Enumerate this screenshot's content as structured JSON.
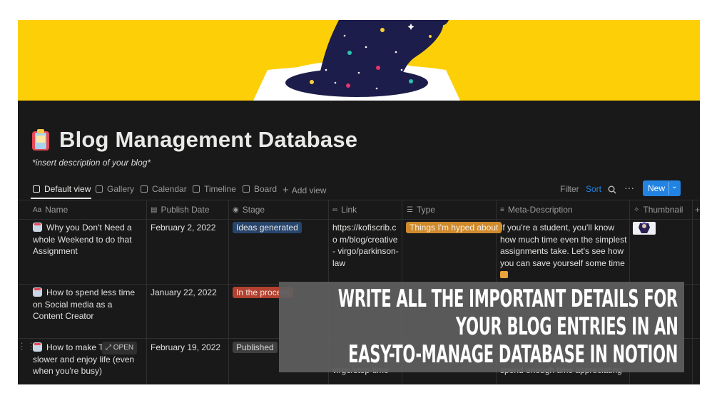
{
  "page": {
    "title": "Blog Management Database",
    "description": "*insert description of your blog*"
  },
  "views": [
    {
      "label": "Default view",
      "icon": "table-icon",
      "active": true
    },
    {
      "label": "Gallery",
      "icon": "gallery-icon"
    },
    {
      "label": "Calendar",
      "icon": "calendar-icon"
    },
    {
      "label": "Timeline",
      "icon": "timeline-icon"
    },
    {
      "label": "Board",
      "icon": "board-icon"
    }
  ],
  "add_view_label": "Add view",
  "toolbar": {
    "filter": "Filter",
    "sort": "Sort",
    "new": "New"
  },
  "columns": [
    {
      "label": "Name",
      "icon": "title-icon"
    },
    {
      "label": "Publish Date",
      "icon": "calendar-icon"
    },
    {
      "label": "Stage",
      "icon": "status-icon"
    },
    {
      "label": "Link",
      "icon": "link-icon"
    },
    {
      "label": "Type",
      "icon": "list-icon"
    },
    {
      "label": "Meta-Description",
      "icon": "text-icon"
    },
    {
      "label": "Thumbnail",
      "icon": "attachment-icon"
    }
  ],
  "rows": [
    {
      "name": "Why you Don't Need a whole Weekend to do that Assignment",
      "date": "February 2, 2022",
      "stage": "Ideas generated",
      "stage_color": "#28456c",
      "link": "https://kofiscrib.co m/blog/creative- virgo/parkinson- law",
      "type": "Things I'm hyped about",
      "type_color": "#d08a2c",
      "meta": "If you're a student, you'll know how much time even the simplest assignments take. Let's see how you can save yourself some time"
    },
    {
      "name": "How to spend less time on Social media as a Content Creator",
      "date": "January 22, 2022",
      "stage": "In the process",
      "stage_color": "#b3412f"
    },
    {
      "name_visible": "How to make Tir",
      "name_rest": "slower and enjoy life (even when you're busy)",
      "date": "February 19, 2022",
      "stage": "Published",
      "stage_color": "#3f3f3f",
      "link_partial": "virgo/stop-time",
      "meta_partial": "spend enough time appreciating"
    }
  ],
  "open_label": "OPEN",
  "overlay_lines": [
    "Write all the important details for",
    "your blog entries in an",
    "easy-to-manage database in Notion"
  ],
  "colors": {
    "cover": "#fdcf07",
    "background": "#191919",
    "accent": "#2383e2"
  }
}
